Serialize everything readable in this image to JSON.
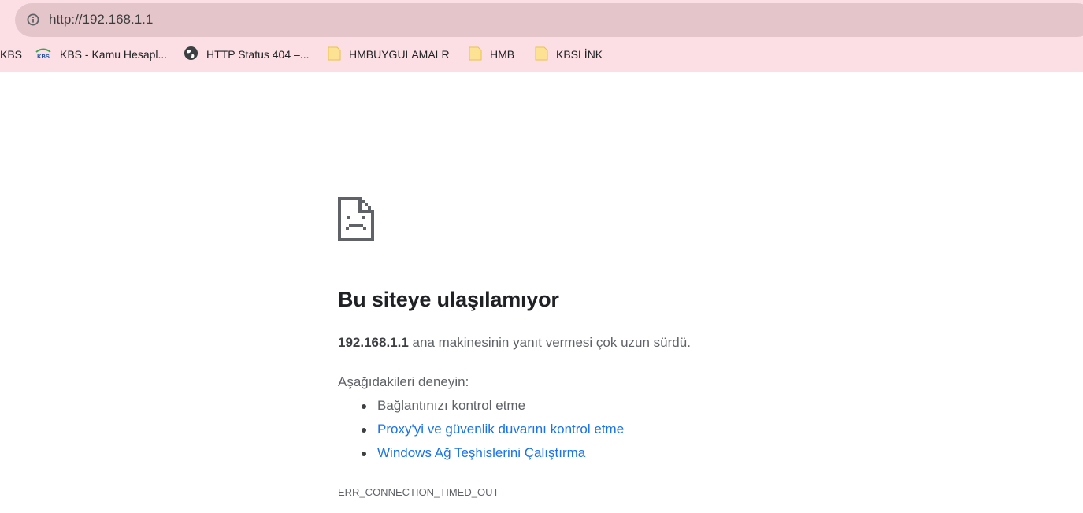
{
  "address_bar": {
    "url": "http://192.168.1.1",
    "info_icon": "info-circle-icon"
  },
  "bookmarks": [
    {
      "label": "KBS",
      "icon": "none"
    },
    {
      "label": "KBS - Kamu Hesapl...",
      "icon": "kbs-logo-icon"
    },
    {
      "label": "HTTP Status 404 –...",
      "icon": "globe-icon"
    },
    {
      "label": "HMBUYGULAMALR",
      "icon": "folder-icon"
    },
    {
      "label": "HMB",
      "icon": "folder-icon"
    },
    {
      "label": "KBSLİNK",
      "icon": "folder-icon"
    }
  ],
  "error_page": {
    "icon": "sad-page-icon",
    "title": "Bu siteye ulaşılamıyor",
    "host": "192.168.1.1",
    "message": " ana makinesinin yanıt vermesi çok uzun sürdü.",
    "try_label": "Aşağıdakileri deneyin:",
    "suggestions": [
      {
        "text": "Bağlantınızı kontrol etme"
      },
      {
        "text": "Proxy'yi ve güvenlik duvarını kontrol etme"
      },
      {
        "text": "Windows Ağ Teşhislerini Çalıştırma"
      }
    ],
    "error_code": "ERR_CONNECTION_TIMED_OUT"
  },
  "colors": {
    "toolbar_bg": "#fbdfe4",
    "omnibox_bg": "#e3c5ca",
    "link": "#1a73e8",
    "folder": "#fde293"
  }
}
